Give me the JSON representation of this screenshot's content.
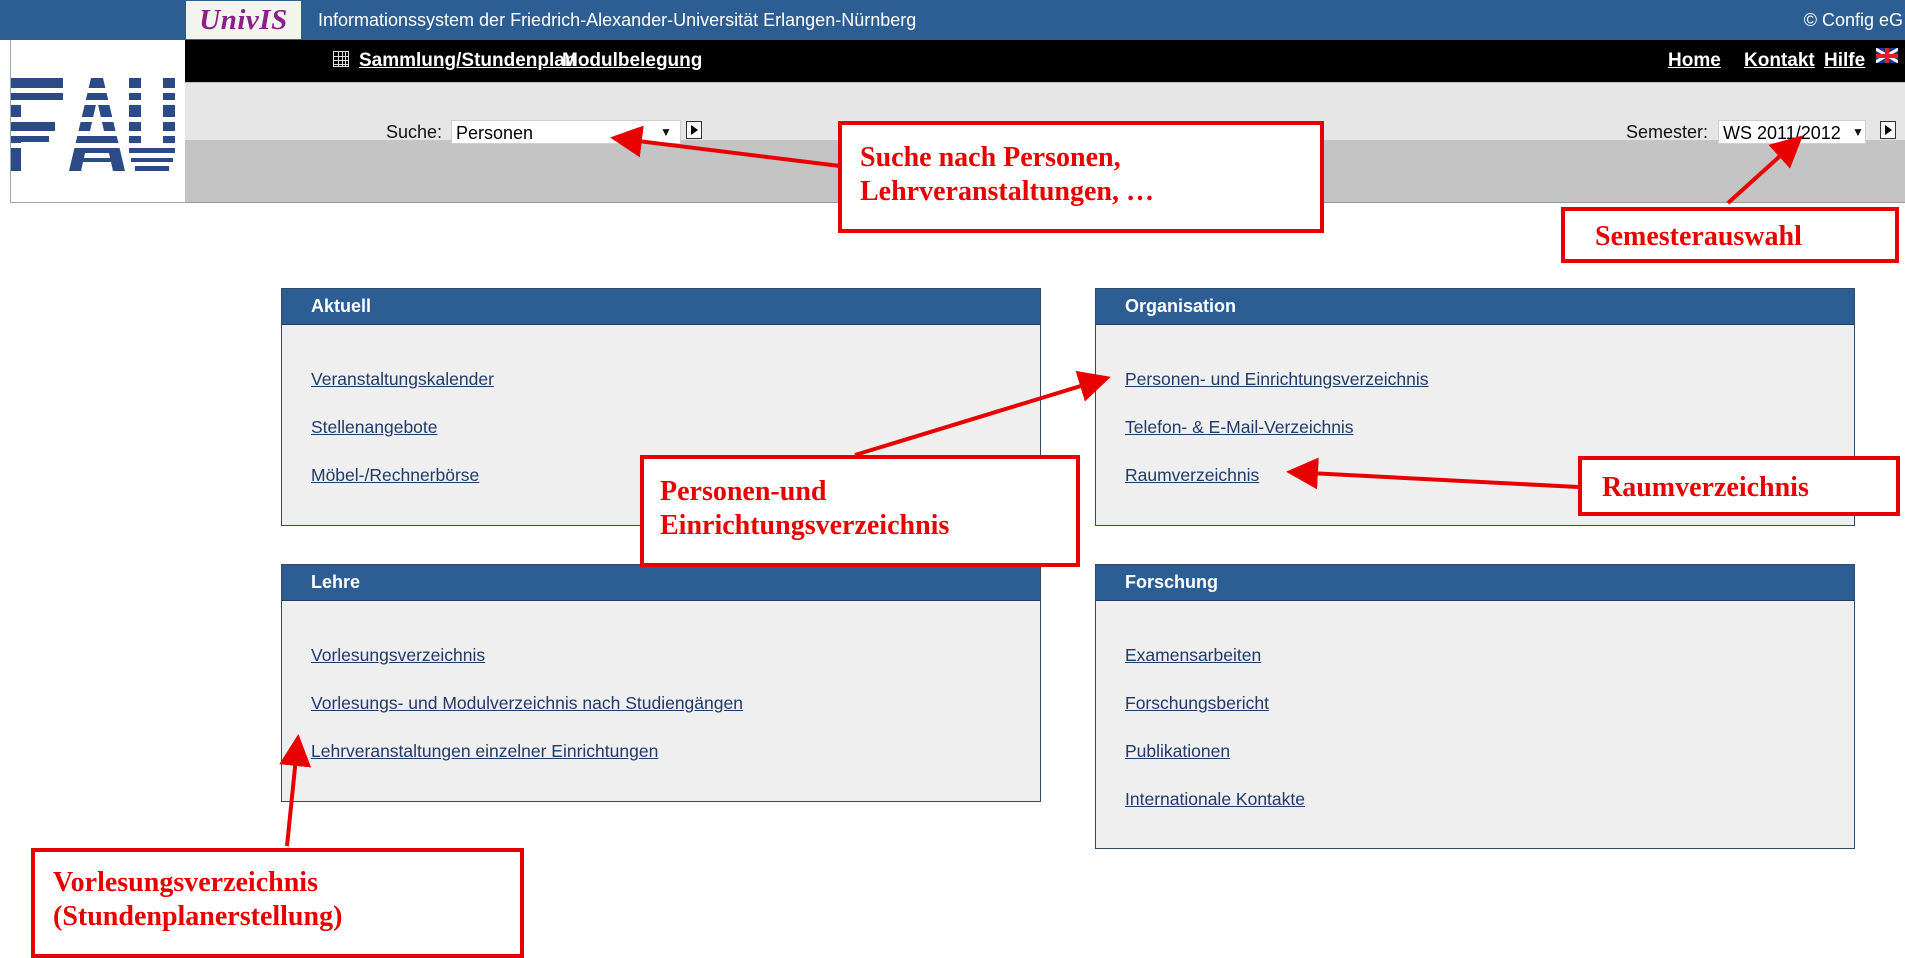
{
  "header": {
    "logo_text": "UnivIS",
    "title": "Informationssystem der Friedrich-Alexander-Universität Erlangen-Nürnberg",
    "copyright": "© Config eG",
    "fau_logo_text": "FAU"
  },
  "nav": {
    "left": [
      "Sammlung/Stundenplan",
      "Modulbelegung"
    ],
    "right": [
      "Home",
      "Kontakt",
      "Hilfe"
    ]
  },
  "search": {
    "label": "Suche:",
    "selected": "Personen"
  },
  "semester": {
    "label": "Semester:",
    "selected": "WS 2011/2012"
  },
  "panels": {
    "aktuell": {
      "title": "Aktuell",
      "links": [
        "Veranstaltungskalender",
        "Stellenangebote",
        "Möbel-/Rechnerbörse"
      ]
    },
    "organisation": {
      "title": "Organisation",
      "links": [
        "Personen- und Einrichtungsverzeichnis",
        "Telefon- & E-Mail-Verzeichnis",
        "Raumverzeichnis"
      ]
    },
    "lehre": {
      "title": "Lehre",
      "links": [
        "Vorlesungsverzeichnis",
        "Vorlesungs- und Modulverzeichnis nach Studiengängen",
        "Lehrveranstaltungen einzelner Einrichtungen"
      ]
    },
    "forschung": {
      "title": "Forschung",
      "links": [
        "Examensarbeiten",
        "Forschungsbericht",
        "Publikationen",
        "Internationale Kontakte"
      ]
    }
  },
  "annotations": {
    "search": [
      "Suche nach Personen,",
      "Lehrveranstaltungen, …"
    ],
    "semester": "Semesterauswahl",
    "personen": [
      "Personen-und",
      "Einrichtungsverzeichnis"
    ],
    "raum": "Raumverzeichnis",
    "vorlesung": [
      "Vorlesungsverzeichnis",
      "(Stundenplanerstellung)"
    ]
  },
  "colors": {
    "header_blue": "#2c5e93",
    "nav_black": "#000000",
    "univis_purple": "#8a1f8a",
    "annotation_red": "#e80000",
    "link_blue": "#1f3b66"
  }
}
